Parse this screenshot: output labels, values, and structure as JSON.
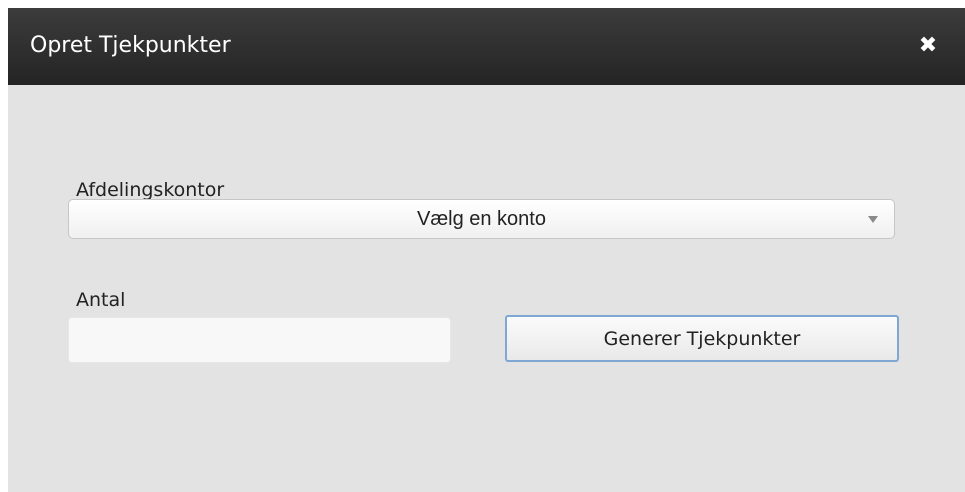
{
  "dialog": {
    "title": "Opret Tjekpunkter",
    "close_icon": "close-icon",
    "close_glyph": "✖"
  },
  "form": {
    "branch_label": "Afdelingskontor",
    "branch_select": {
      "selected": "Vælg en konto",
      "arrow_icon": "chevron-down-icon"
    },
    "quantity_label": "Antal",
    "quantity_input": {
      "value": "",
      "placeholder": ""
    },
    "generate_button_label": "Generer Tjekpunkter"
  },
  "colors": {
    "titlebar": "#2e2e2e",
    "body": "#e3e3e3",
    "button_border": "#7fa7d4"
  }
}
